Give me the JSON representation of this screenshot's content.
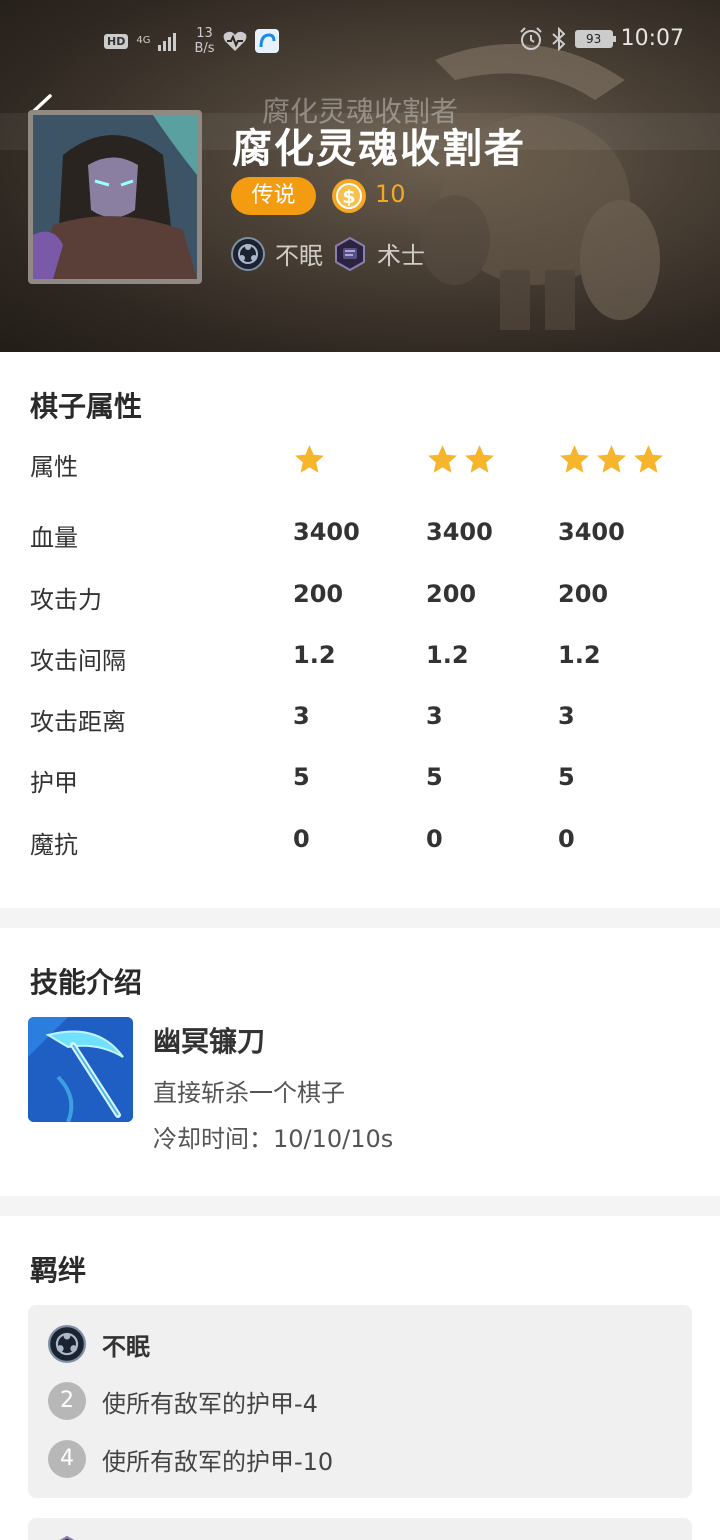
{
  "status_bar": {
    "network": "4G",
    "speed_value": "13",
    "speed_unit": "B/s",
    "battery": "93",
    "time": "10:07"
  },
  "header": {
    "nav_title": "腐化灵魂收割者",
    "hero_name": "腐化灵魂收割者",
    "rarity": "传说",
    "cost": "10",
    "traits": [
      {
        "icon": "insomnia-race-icon",
        "label": "不眠"
      },
      {
        "icon": "warlock-class-icon",
        "label": "术士"
      }
    ]
  },
  "attributes": {
    "title": "棋子属性",
    "header_label": "属性",
    "star_levels": [
      1,
      2,
      3
    ],
    "rows": [
      {
        "label": "血量",
        "values": [
          "3400",
          "3400",
          "3400"
        ]
      },
      {
        "label": "攻击力",
        "values": [
          "200",
          "200",
          "200"
        ]
      },
      {
        "label": "攻击间隔",
        "values": [
          "1.2",
          "1.2",
          "1.2"
        ]
      },
      {
        "label": "攻击距离",
        "values": [
          "3",
          "3",
          "3"
        ]
      },
      {
        "label": "护甲",
        "values": [
          "5",
          "5",
          "5"
        ]
      },
      {
        "label": "魔抗",
        "values": [
          "0",
          "0",
          "0"
        ]
      }
    ]
  },
  "skill": {
    "title": "技能介绍",
    "name": "幽冥镰刀",
    "description": "直接斩杀一个棋子",
    "cooldown": "冷却时间：10/10/10s"
  },
  "bonds": {
    "title": "羁绊",
    "items": [
      {
        "name": "不眠",
        "tiers": [
          {
            "count": "2",
            "effect": "使所有敌军的护甲-4"
          },
          {
            "count": "4",
            "effect": "使所有敌军的护甲-10"
          }
        ]
      }
    ]
  },
  "colors": {
    "accent": "#f39c12",
    "cost": "#f5a623",
    "star": "#f7b52c"
  }
}
